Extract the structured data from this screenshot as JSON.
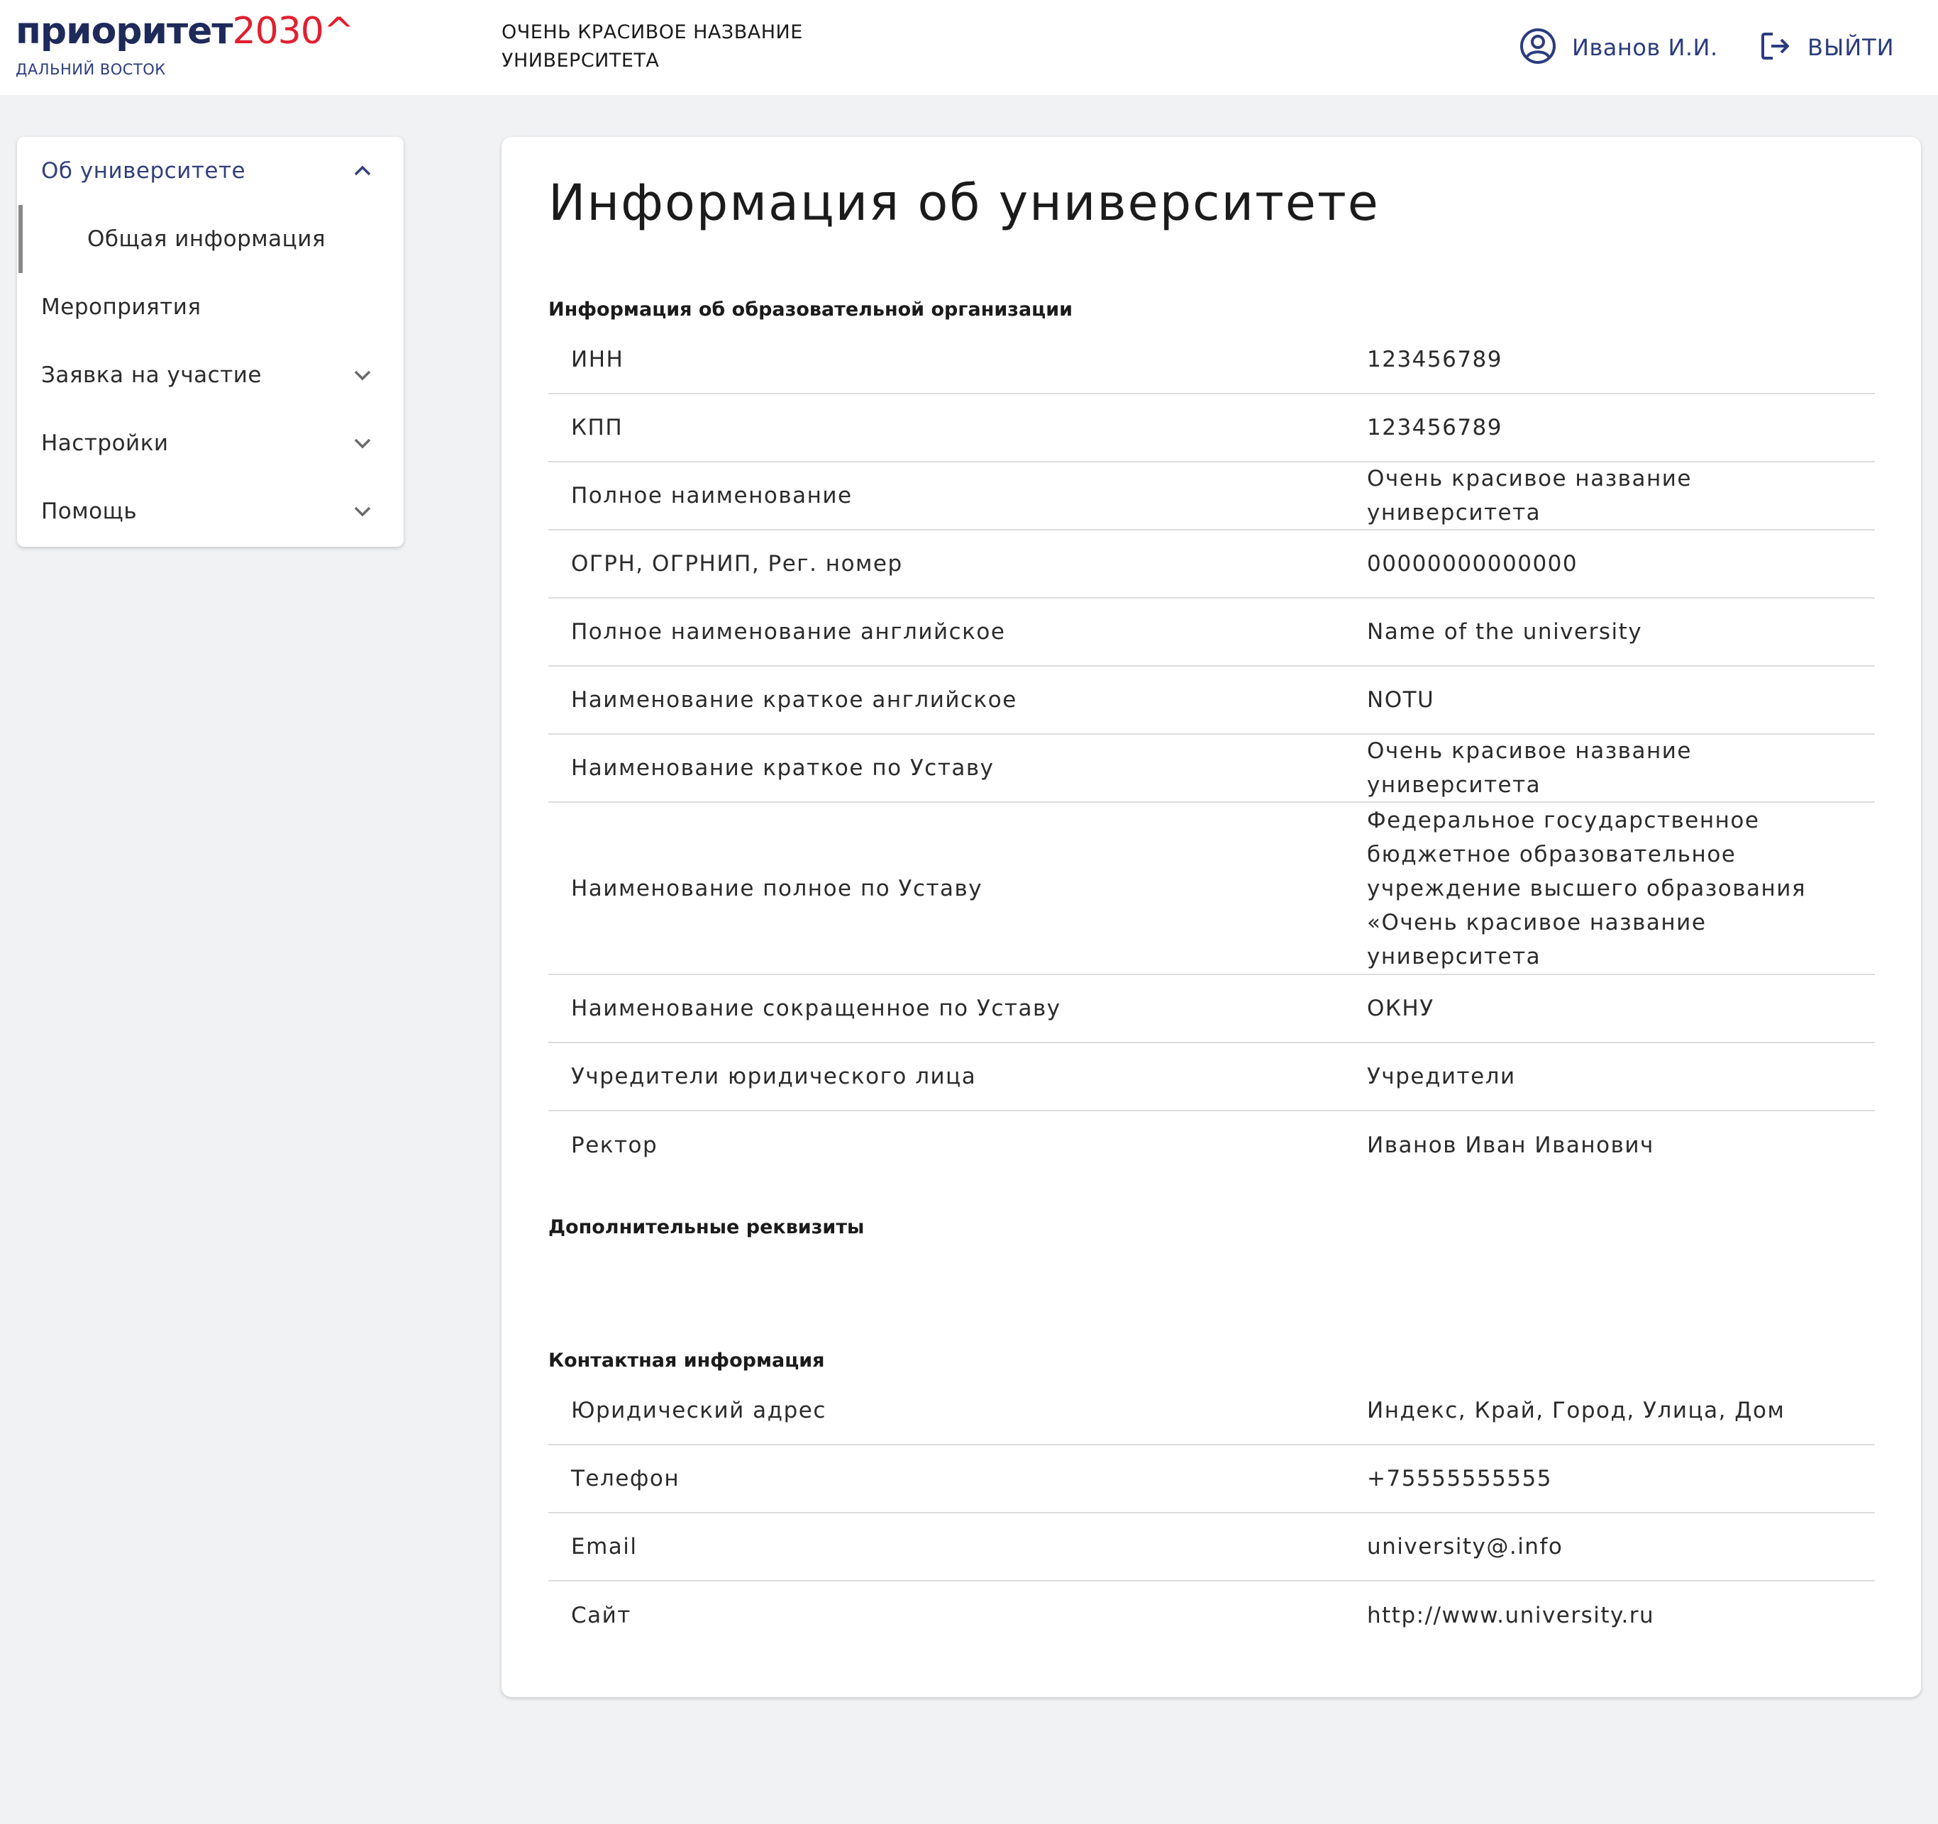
{
  "header": {
    "logo": {
      "main": "приоритет",
      "accent": "2030^",
      "sub": "дальний восток"
    },
    "university_title": "Очень красивое название университета",
    "user_name": "Иванов И.И.",
    "logout_label": "Выйти",
    "brand_color": "#2b3c7e",
    "accent_color": "#e0202f"
  },
  "sidebar": {
    "items": [
      {
        "label": "Об университете",
        "icon": "chevron-up-icon"
      },
      {
        "label": "Общая информация"
      },
      {
        "label": "Мероприятия"
      },
      {
        "label": "Заявка на участие",
        "icon": "chevron-down-icon"
      },
      {
        "label": "Настройки",
        "icon": "chevron-down-icon"
      },
      {
        "label": "Помощь",
        "icon": "chevron-down-icon"
      }
    ]
  },
  "main": {
    "title": "Информация об университете",
    "org_section": {
      "title": "Информация об образовательной организации",
      "rows": [
        {
          "label": "ИНН",
          "value": "123456789"
        },
        {
          "label": "КПП",
          "value": "123456789"
        },
        {
          "label": "Полное наименование",
          "value": "Очень красивое название университета"
        },
        {
          "label": "ОГРН, ОГРНИП, Рег. номер",
          "value": "00000000000000"
        },
        {
          "label": "Полное наименование английское",
          "value": "Name of the university"
        },
        {
          "label": "Наименование краткое английское",
          "value": "NOTU"
        },
        {
          "label": "Наименование краткое по Уставу",
          "value": "Очень красивое название университета"
        },
        {
          "label": "Наименование полное по Уставу",
          "value": "Федеральное государственное бюджетное образовательное учреждение высшего образования «Очень красивое название университета"
        },
        {
          "label": "Наименование сокращенное по Уставу",
          "value": "ОКНУ"
        },
        {
          "label": "Учредители юридического лица",
          "value": "Учредители"
        },
        {
          "label": "Ректор",
          "value": "Иванов Иван Иванович"
        }
      ]
    },
    "extra_section": {
      "title": "Дополнительные реквизиты"
    },
    "contact_section": {
      "title": "Контактная информация",
      "rows": [
        {
          "label": "Юридический адрес",
          "value": "Индекс, Край, Город, Улица, Дом"
        },
        {
          "label": "Телефон",
          "value": "+75555555555"
        },
        {
          "label": "Email",
          "value": "university@.info"
        },
        {
          "label": "Сайт",
          "value": "http://www.university.ru"
        }
      ]
    }
  }
}
